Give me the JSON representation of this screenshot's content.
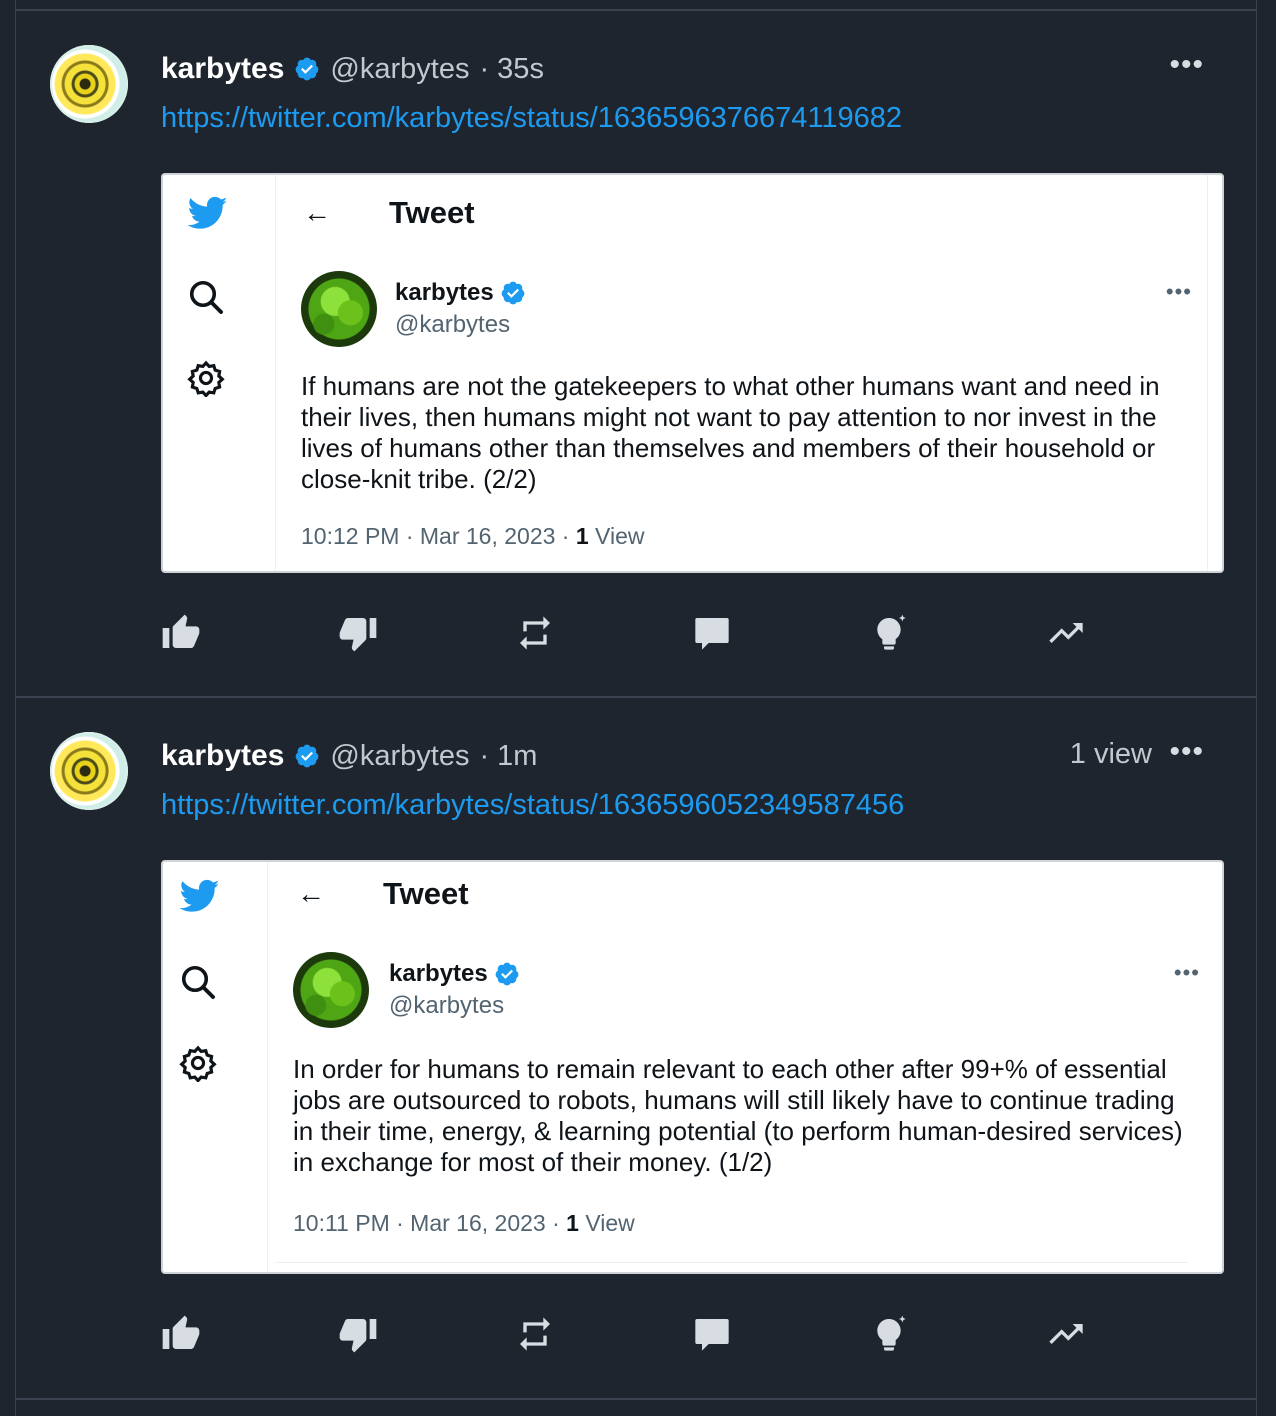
{
  "posts": [
    {
      "name": "karbytes",
      "handle": "@karbytes",
      "time": "· 35s",
      "views": "",
      "more": "•••",
      "link": "https://twitter.com/karbytes/status/1636596376674119682",
      "screenshot": {
        "title": "Tweet",
        "back": "←",
        "name": "karbytes",
        "handle": "@karbytes",
        "more": "•••",
        "body": "If humans are not the gatekeepers to what other humans want and need in their lives, then humans might not want to pay attention to nor invest in the lives of humans other than themselves and members of their household or close-knit tribe. (2/2)",
        "meta_time": "10:12 PM · Mar 16, 2023 · ",
        "meta_count": "1",
        "meta_label": " View"
      }
    },
    {
      "name": "karbytes",
      "handle": "@karbytes",
      "time": "· 1m",
      "views": "1 view",
      "more": "•••",
      "link": "https://twitter.com/karbytes/status/1636596052349587456",
      "screenshot": {
        "title": "Tweet",
        "back": "←",
        "name": "karbytes",
        "handle": "@karbytes",
        "more": "•••",
        "body": "In order for humans to remain relevant to each other after 99+% of essential jobs are outsourced to robots, humans will still likely have to continue trading in their time, energy, & learning potential (to perform human-desired services) in exchange for most of their money. (1/2)",
        "meta_time": "10:11 PM · Mar 16, 2023 · ",
        "meta_count": "1",
        "meta_label": " View"
      }
    }
  ],
  "actions": [
    "like-icon",
    "dislike-icon",
    "repost-icon",
    "comment-icon",
    "insight-icon",
    "analytics-icon"
  ],
  "colors": {
    "background": "#1f252e",
    "link": "#1d9bf0",
    "verified": "#1d9bf0"
  }
}
